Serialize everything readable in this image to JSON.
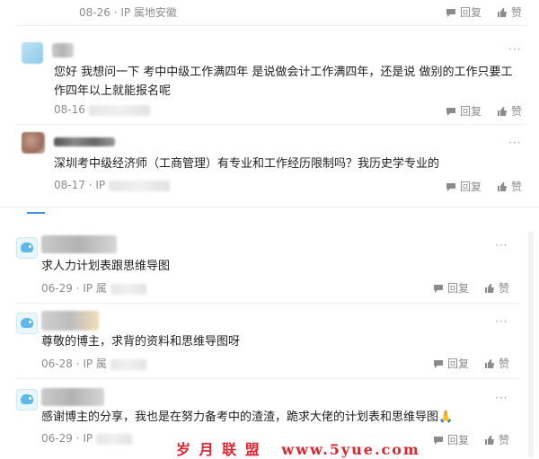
{
  "actions": {
    "reply": "回复",
    "like": "赞",
    "more": "···"
  },
  "top_comments": [
    {
      "date": "08-26",
      "ip": "IP 属地安徽"
    },
    {
      "text": "您好 我想问一下 考中中级工作满四年 是说做会计工作满四年，还是说 做别的工作只要工作四年以上就能报名呢",
      "date": "08-16"
    },
    {
      "text": "深圳考中级经济师（工商管理）有专业和工作经历限制吗？我历史学专业的",
      "date": "08-17",
      "ip": "IP"
    }
  ],
  "bottom_comments": [
    {
      "text": "求人力计划表跟思维导图",
      "date": "06-29",
      "ip": "IP 属"
    },
    {
      "text": "尊敬的博主，求背的资料和思维导图呀",
      "date": "06-28",
      "ip": "IP 属"
    },
    {
      "text": "感谢博主的分享，我也是在努力备考中的渣渣，跪求大佬的计划表和思维导图🙏",
      "date": "06-29",
      "ip": "IP"
    }
  ],
  "watermark": "岁 月 联 盟   www.5yue.com",
  "colors": {
    "accent": "#3a8ee6",
    "watermark": "#e0242f",
    "meta": "#8c8c8c"
  }
}
